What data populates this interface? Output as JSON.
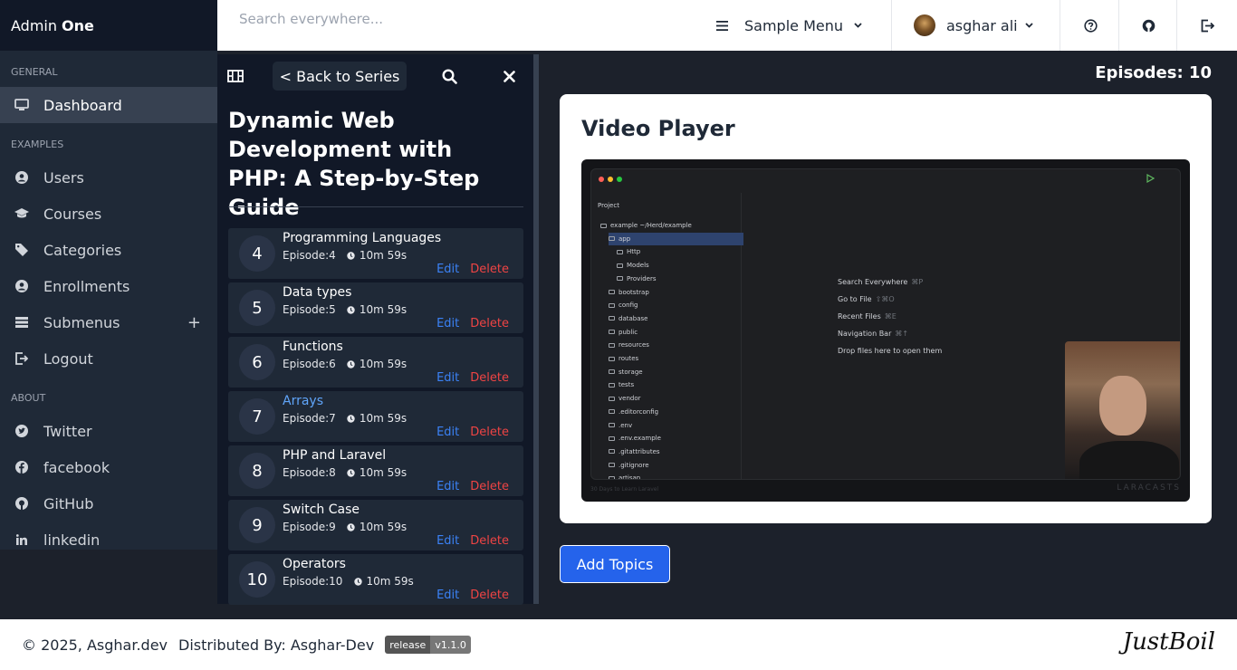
{
  "app": {
    "brand_part1": "Admin",
    "brand_part2": "One"
  },
  "search": {
    "placeholder": "Search everywhere..."
  },
  "navbar": {
    "menu_label": "Sample Menu",
    "user_name": "asghar ali"
  },
  "sidebar": {
    "groups": [
      {
        "label": "GENERAL"
      },
      {
        "label": "EXAMPLES"
      },
      {
        "label": "ABOUT"
      }
    ],
    "items": [
      {
        "label": "Dashboard",
        "icon": "monitor-icon"
      },
      {
        "label": "Users",
        "icon": "user-circle-icon"
      },
      {
        "label": "Courses",
        "icon": "graduation-cap-icon"
      },
      {
        "label": "Categories",
        "icon": "tag-icon"
      },
      {
        "label": "Enrollments",
        "icon": "user-circle-icon"
      },
      {
        "label": "Submenus",
        "icon": "list-icon"
      },
      {
        "label": "Logout",
        "icon": "logout-icon"
      },
      {
        "label": "Twitter",
        "icon": "twitter-icon"
      },
      {
        "label": "facebook",
        "icon": "facebook-icon"
      },
      {
        "label": "GitHub",
        "icon": "github-icon"
      },
      {
        "label": "linkedin",
        "icon": "linkedin-icon"
      }
    ]
  },
  "panel": {
    "back_label": "< Back to Series",
    "series_title": "Dynamic Web Development with PHP: A Step-by-Step Guide",
    "edit_label": "Edit",
    "delete_label": "Delete",
    "episodes": [
      {
        "number": "4",
        "title": "Programming Languages",
        "episode": "Episode:4",
        "duration": "10m 59s"
      },
      {
        "number": "5",
        "title": "Data types",
        "episode": "Episode:5",
        "duration": "10m 59s"
      },
      {
        "number": "6",
        "title": "Functions",
        "episode": "Episode:6",
        "duration": "10m 59s"
      },
      {
        "number": "7",
        "title": "Arrays",
        "episode": "Episode:7",
        "duration": "10m 59s",
        "current": true
      },
      {
        "number": "8",
        "title": "PHP and Laravel",
        "episode": "Episode:8",
        "duration": "10m 59s"
      },
      {
        "number": "9",
        "title": "Switch Case",
        "episode": "Episode:9",
        "duration": "10m 59s"
      },
      {
        "number": "10",
        "title": "Operators",
        "episode": "Episode:10",
        "duration": "10m 59s"
      }
    ]
  },
  "main": {
    "episode_count": "Episodes: 10",
    "card_title": "Video Player",
    "add_topics_label": "Add Topics"
  },
  "video": {
    "project_label": "Project",
    "tree": [
      {
        "label": "example ~/Herd/example"
      },
      {
        "label": "app",
        "selected": true
      },
      {
        "label": "Http"
      },
      {
        "label": "Models"
      },
      {
        "label": "Providers"
      },
      {
        "label": "bootstrap"
      },
      {
        "label": "config"
      },
      {
        "label": "database"
      },
      {
        "label": "public"
      },
      {
        "label": "resources"
      },
      {
        "label": "routes"
      },
      {
        "label": "storage"
      },
      {
        "label": "tests"
      },
      {
        "label": "vendor"
      },
      {
        "label": ".editorconfig"
      },
      {
        "label": ".env"
      },
      {
        "label": ".env.example"
      },
      {
        "label": ".gitattributes"
      },
      {
        "label": ".gitignore"
      },
      {
        "label": "artisan"
      }
    ],
    "tips": [
      {
        "label": "Search Everywhere",
        "key": "⌘P"
      },
      {
        "label": "Go to File",
        "key": "⇧⌘O"
      },
      {
        "label": "Recent Files",
        "key": "⌘E"
      },
      {
        "label": "Navigation Bar",
        "key": "⌘↑"
      },
      {
        "label": "Drop files here to open them",
        "key": ""
      }
    ],
    "watermark": "LARACASTS",
    "caption": "30 Days to Learn Laravel"
  },
  "footer": {
    "copyright": "© 2025, Asghar.dev",
    "distributed": "Distributed By: Asghar-Dev",
    "badge_label": "release",
    "badge_version": "v1.1.0",
    "signature": "JustBoil"
  },
  "colors": {
    "accent": "#2563eb",
    "edit": "#3b82f6",
    "delete": "#ef4444",
    "current_episode": "#60a5fa"
  }
}
